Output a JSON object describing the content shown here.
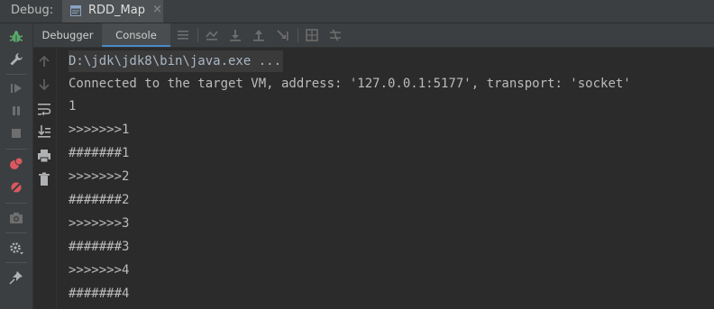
{
  "titlebar": {
    "label": "Debug:",
    "run_tab": {
      "label": "RDD_Map",
      "close": "×"
    }
  },
  "tabs": {
    "debugger": "Debugger",
    "console": "Console"
  },
  "console": {
    "lines": [
      "D:\\jdk\\jdk8\\bin\\java.exe ...",
      "Connected to the target VM, address: '127.0.0.1:5177', transport: 'socket'",
      "1",
      ">>>>>>>1",
      "#######1",
      ">>>>>>>2",
      "#######2",
      ">>>>>>>3",
      "#######3",
      ">>>>>>>4",
      "#######4"
    ]
  },
  "icons": {
    "left_toolbar": [
      "bug-icon",
      "wrench-icon",
      "resume-icon",
      "pause-icon",
      "stop-icon",
      "view-breakpoints-icon",
      "mute-breakpoints-icon",
      "camera-icon",
      "settings-icon",
      "pin-icon"
    ],
    "tab_toolbar": [
      "menu-icon",
      "show-execution-point-icon",
      "step-over-icon",
      "step-into-icon",
      "step-out-icon",
      "run-to-cursor-icon",
      "evaluate-expression-icon",
      "trace-icon"
    ],
    "console_toolbar": [
      "up-arrow-icon",
      "down-arrow-icon",
      "soft-wrap-icon",
      "scroll-to-end-icon",
      "print-icon",
      "trash-icon"
    ]
  },
  "colors": {
    "background": "#2b2b2b",
    "toolbar": "#3c3f41",
    "text": "#bbbbbb",
    "accent": "#4a88c7",
    "bug_green": "#59a869",
    "breakpoint_red": "#db5860"
  }
}
